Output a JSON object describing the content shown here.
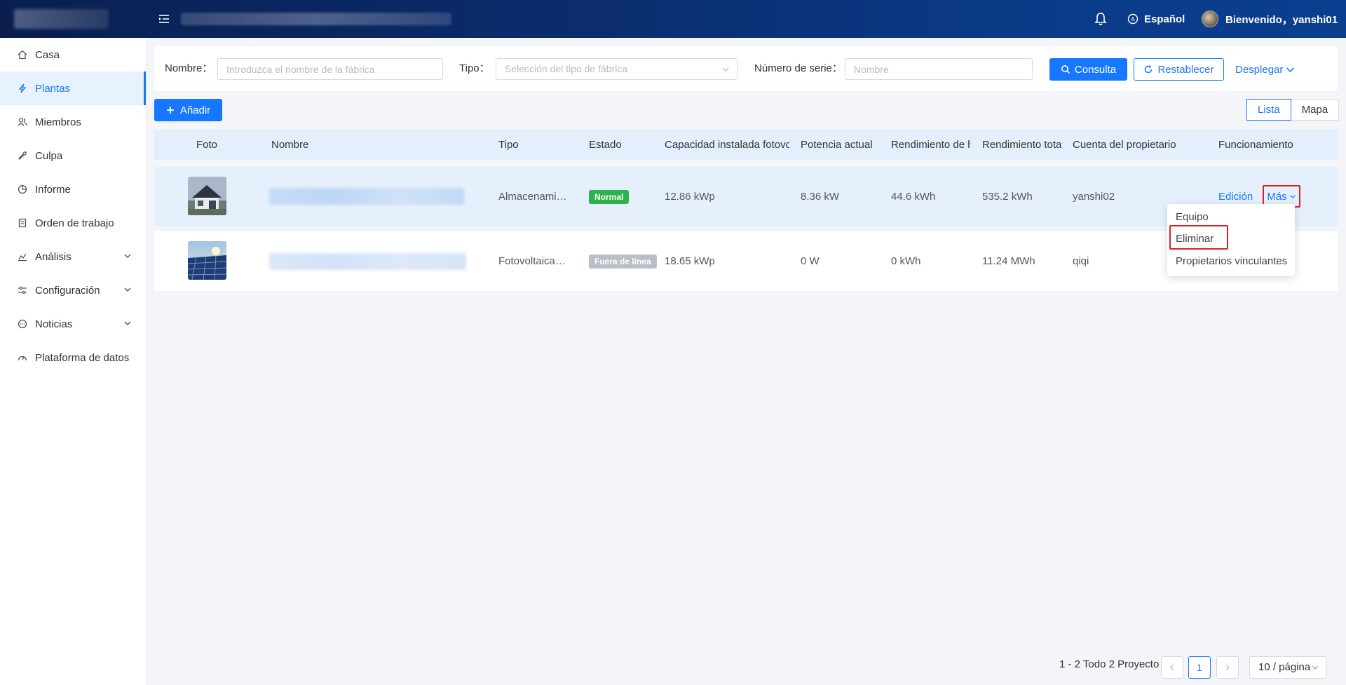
{
  "header": {
    "language": "Español",
    "welcome": "Bienvenido，yanshi01"
  },
  "sidebar": {
    "items": [
      {
        "label": "Casa",
        "icon": "home-icon",
        "active": false,
        "expandable": false
      },
      {
        "label": "Plantas",
        "icon": "lightning-icon",
        "active": true,
        "expandable": false
      },
      {
        "label": "Miembros",
        "icon": "users-icon",
        "active": false,
        "expandable": false
      },
      {
        "label": "Culpa",
        "icon": "wrench-icon",
        "active": false,
        "expandable": false
      },
      {
        "label": "Informe",
        "icon": "pie-chart-icon",
        "active": false,
        "expandable": false
      },
      {
        "label": "Orden de trabajo",
        "icon": "clipboard-icon",
        "active": false,
        "expandable": false
      },
      {
        "label": "Análisis",
        "icon": "bar-chart-icon",
        "active": false,
        "expandable": true
      },
      {
        "label": "Configuración",
        "icon": "sliders-icon",
        "active": false,
        "expandable": true
      },
      {
        "label": "Noticias",
        "icon": "chat-icon",
        "active": false,
        "expandable": true
      },
      {
        "label": "Plataforma de datos",
        "icon": "gauge-icon",
        "active": false,
        "expandable": false
      }
    ]
  },
  "filters": {
    "name_label": "Nombre",
    "name_placeholder": "Introduzca el nombre de la fábrica",
    "type_label": "Tipo",
    "type_placeholder": "Selección del tipo de fábrica",
    "serial_label": "Número de serie",
    "serial_placeholder": "Nombre",
    "search_button": "Consulta",
    "reset_button": "Restablecer",
    "expand_link": "Desplegar"
  },
  "toolbar": {
    "add_button": "Añadir",
    "view_list": "Lista",
    "view_map": "Mapa"
  },
  "table": {
    "columns": [
      "Foto",
      "Nombre",
      "Tipo",
      "Estado",
      "Capacidad instalada fotovo",
      "Potencia actual",
      "Rendimiento de h",
      "Rendimiento tota",
      "Cuenta del propietario",
      "Funcionamiento"
    ],
    "rows": [
      {
        "tipo": "Almacenami…",
        "estado": "Normal",
        "estado_color": "#2db34a",
        "capacidad": "12.86 kWp",
        "potencia": "8.36 kW",
        "rend_hoy": "44.6 kWh",
        "rend_total": "535.2 kWh",
        "cuenta": "yanshi02"
      },
      {
        "tipo": "Fotovoltaica…",
        "estado": "Fuera de línea",
        "estado_color": "#b9bec7",
        "capacidad": "18.65 kWp",
        "potencia": "0 W",
        "rend_hoy": "0 kWh",
        "rend_total": "11.24 MWh",
        "cuenta": "qiqi"
      }
    ],
    "edit_link": "Edición",
    "more_link": "Más"
  },
  "dropdown": {
    "items": [
      "Equipo",
      "Eliminar",
      "Propietarios vinculantes"
    ]
  },
  "pagination": {
    "summary": "1 - 2 Todo 2 Proyecto",
    "current_page": "1",
    "page_size": "10 / página"
  },
  "colors": {
    "accent": "#1677ff",
    "highlight": "#e02020"
  }
}
